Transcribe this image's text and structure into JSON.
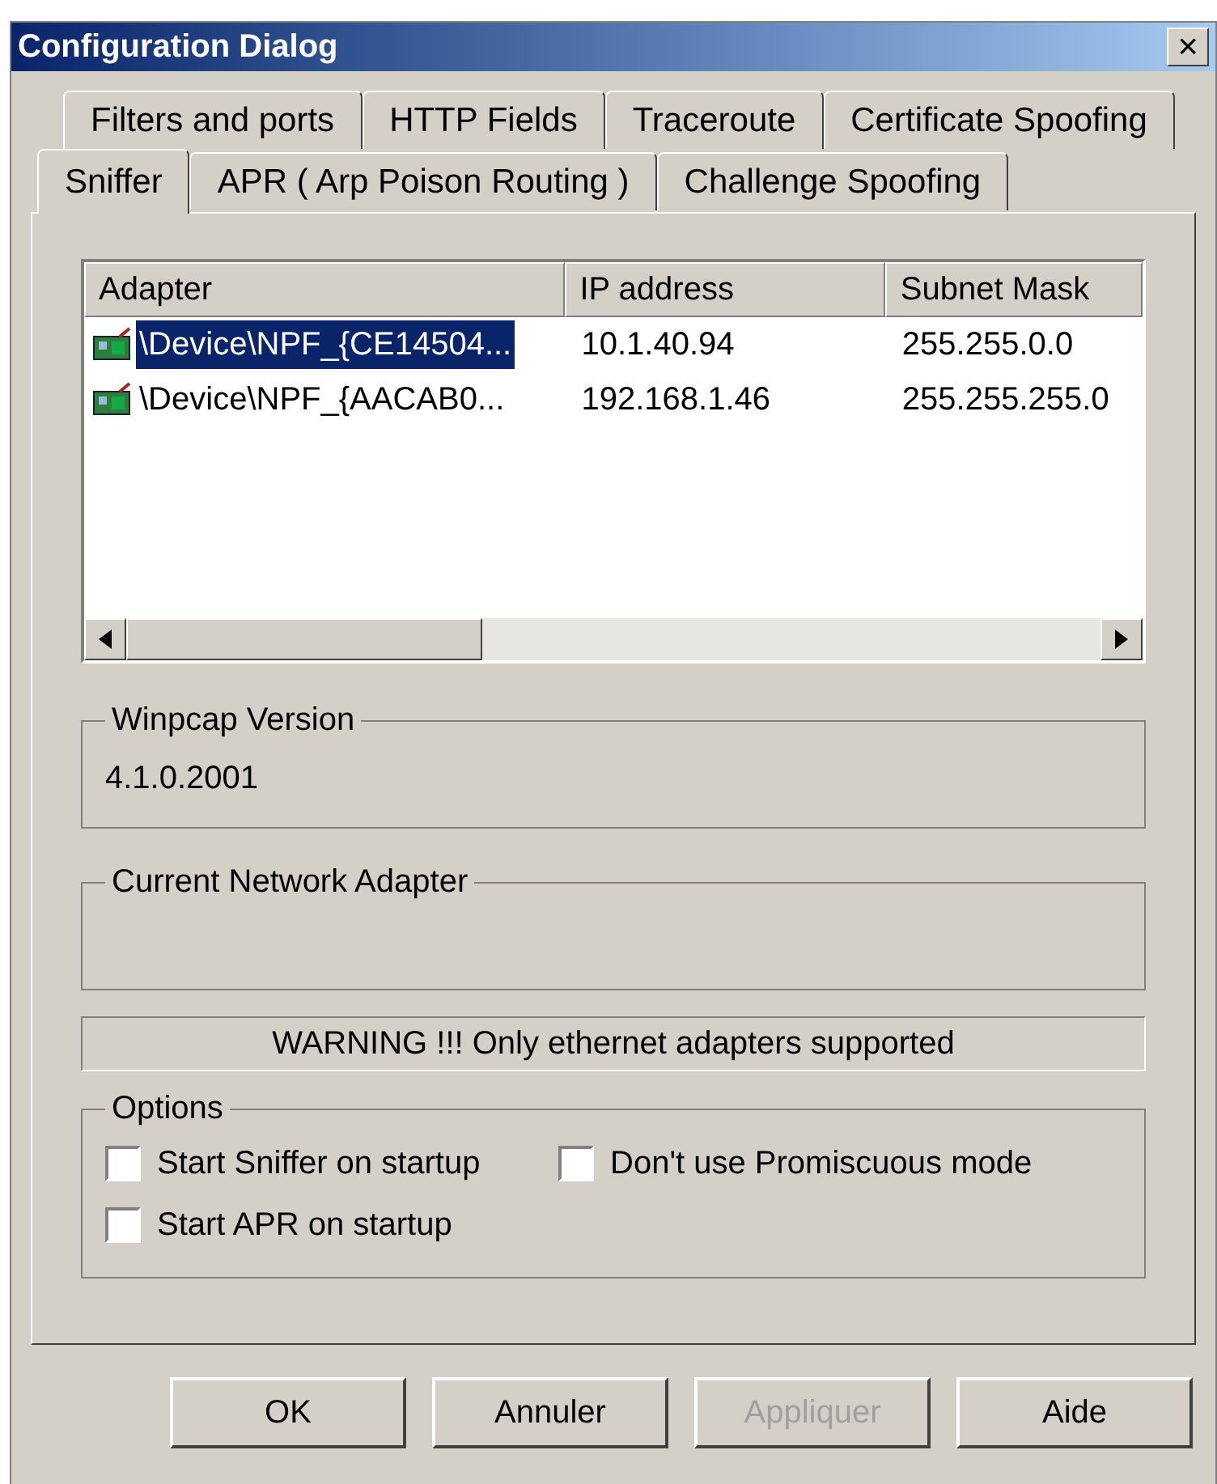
{
  "window": {
    "title": "Configuration Dialog",
    "close": "×"
  },
  "tab_rows": [
    [
      {
        "label": "Filters and ports",
        "selected": false
      },
      {
        "label": "HTTP Fields",
        "selected": false
      },
      {
        "label": "Traceroute",
        "selected": false
      },
      {
        "label": "Certificate Spoofing",
        "selected": false
      }
    ],
    [
      {
        "label": "Sniffer",
        "selected": true
      },
      {
        "label": "APR ( Arp Poison Routing )",
        "selected": false
      },
      {
        "label": "Challenge Spoofing",
        "selected": false
      }
    ]
  ],
  "adapters": {
    "columns": [
      "Adapter",
      "IP address",
      "Subnet Mask"
    ],
    "rows": [
      {
        "cells": [
          "\\Device\\NPF_{CE14504...",
          "10.1.40.94",
          "255.255.0.0"
        ],
        "selected": true
      },
      {
        "cells": [
          "\\Device\\NPF_{AACAB0...",
          "192.168.1.46",
          "255.255.255.0"
        ],
        "selected": false
      }
    ]
  },
  "winpcap": {
    "label": "Winpcap Version",
    "value": "4.1.0.2001"
  },
  "current_adapter": {
    "label": "Current Network Adapter"
  },
  "warning": "WARNING !!! Only ethernet adapters supported",
  "options": {
    "label": "Options",
    "items": [
      {
        "label": "Start Sniffer on startup",
        "checked": false
      },
      {
        "label": "Don't use Promiscuous mode",
        "checked": false
      },
      {
        "label": "Start APR on startup",
        "checked": false
      }
    ]
  },
  "buttons": [
    {
      "label": "OK",
      "disabled": false
    },
    {
      "label": "Annuler",
      "disabled": false
    },
    {
      "label": "Appliquer",
      "disabled": true
    },
    {
      "label": "Aide",
      "disabled": false
    }
  ]
}
